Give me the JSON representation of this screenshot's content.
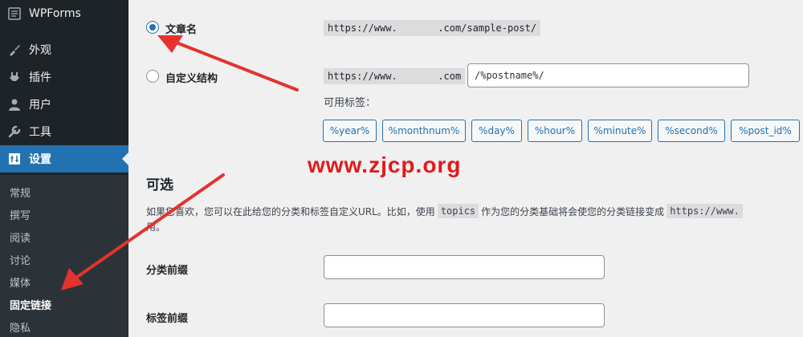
{
  "sidebar": {
    "items": [
      {
        "label": "WPForms",
        "icon": "wpforms-icon"
      },
      {
        "label": "外观",
        "icon": "paintbrush-icon"
      },
      {
        "label": "插件",
        "icon": "plugin-icon"
      },
      {
        "label": "用户",
        "icon": "user-icon"
      },
      {
        "label": "工具",
        "icon": "wrench-icon"
      },
      {
        "label": "设置",
        "icon": "settings-icon"
      }
    ],
    "submenu": [
      "常规",
      "撰写",
      "阅读",
      "讨论",
      "媒体",
      "固定链接",
      "隐私"
    ]
  },
  "permalink": {
    "post_name_label": "文章名",
    "post_name_url": "https://www.       .com/sample-post/",
    "custom_label": "自定义结构",
    "custom_base": "https://www.       .com",
    "custom_value": "/%postname%/",
    "tags_label": "可用标签：",
    "tags": [
      "%year%",
      "%monthnum%",
      "%day%",
      "%hour%",
      "%minute%",
      "%second%",
      "%post_id%"
    ]
  },
  "optional": {
    "heading": "可选",
    "desc_part1": "如果您喜欢，您可以在此给您的分类和标签自定义URL。比如，使用",
    "desc_code": "topics",
    "desc_part2": "作为您的分类基础将会使您的分类链接变成",
    "desc_url": "https://www.",
    "desc_line2": "用。",
    "category_label": "分类前缀",
    "tag_label": "标签前缀"
  },
  "watermark": "www.zjcp.org",
  "colors": {
    "accent": "#2271b1",
    "arrow": "#e5322d",
    "sidebar": "#1d2327"
  }
}
